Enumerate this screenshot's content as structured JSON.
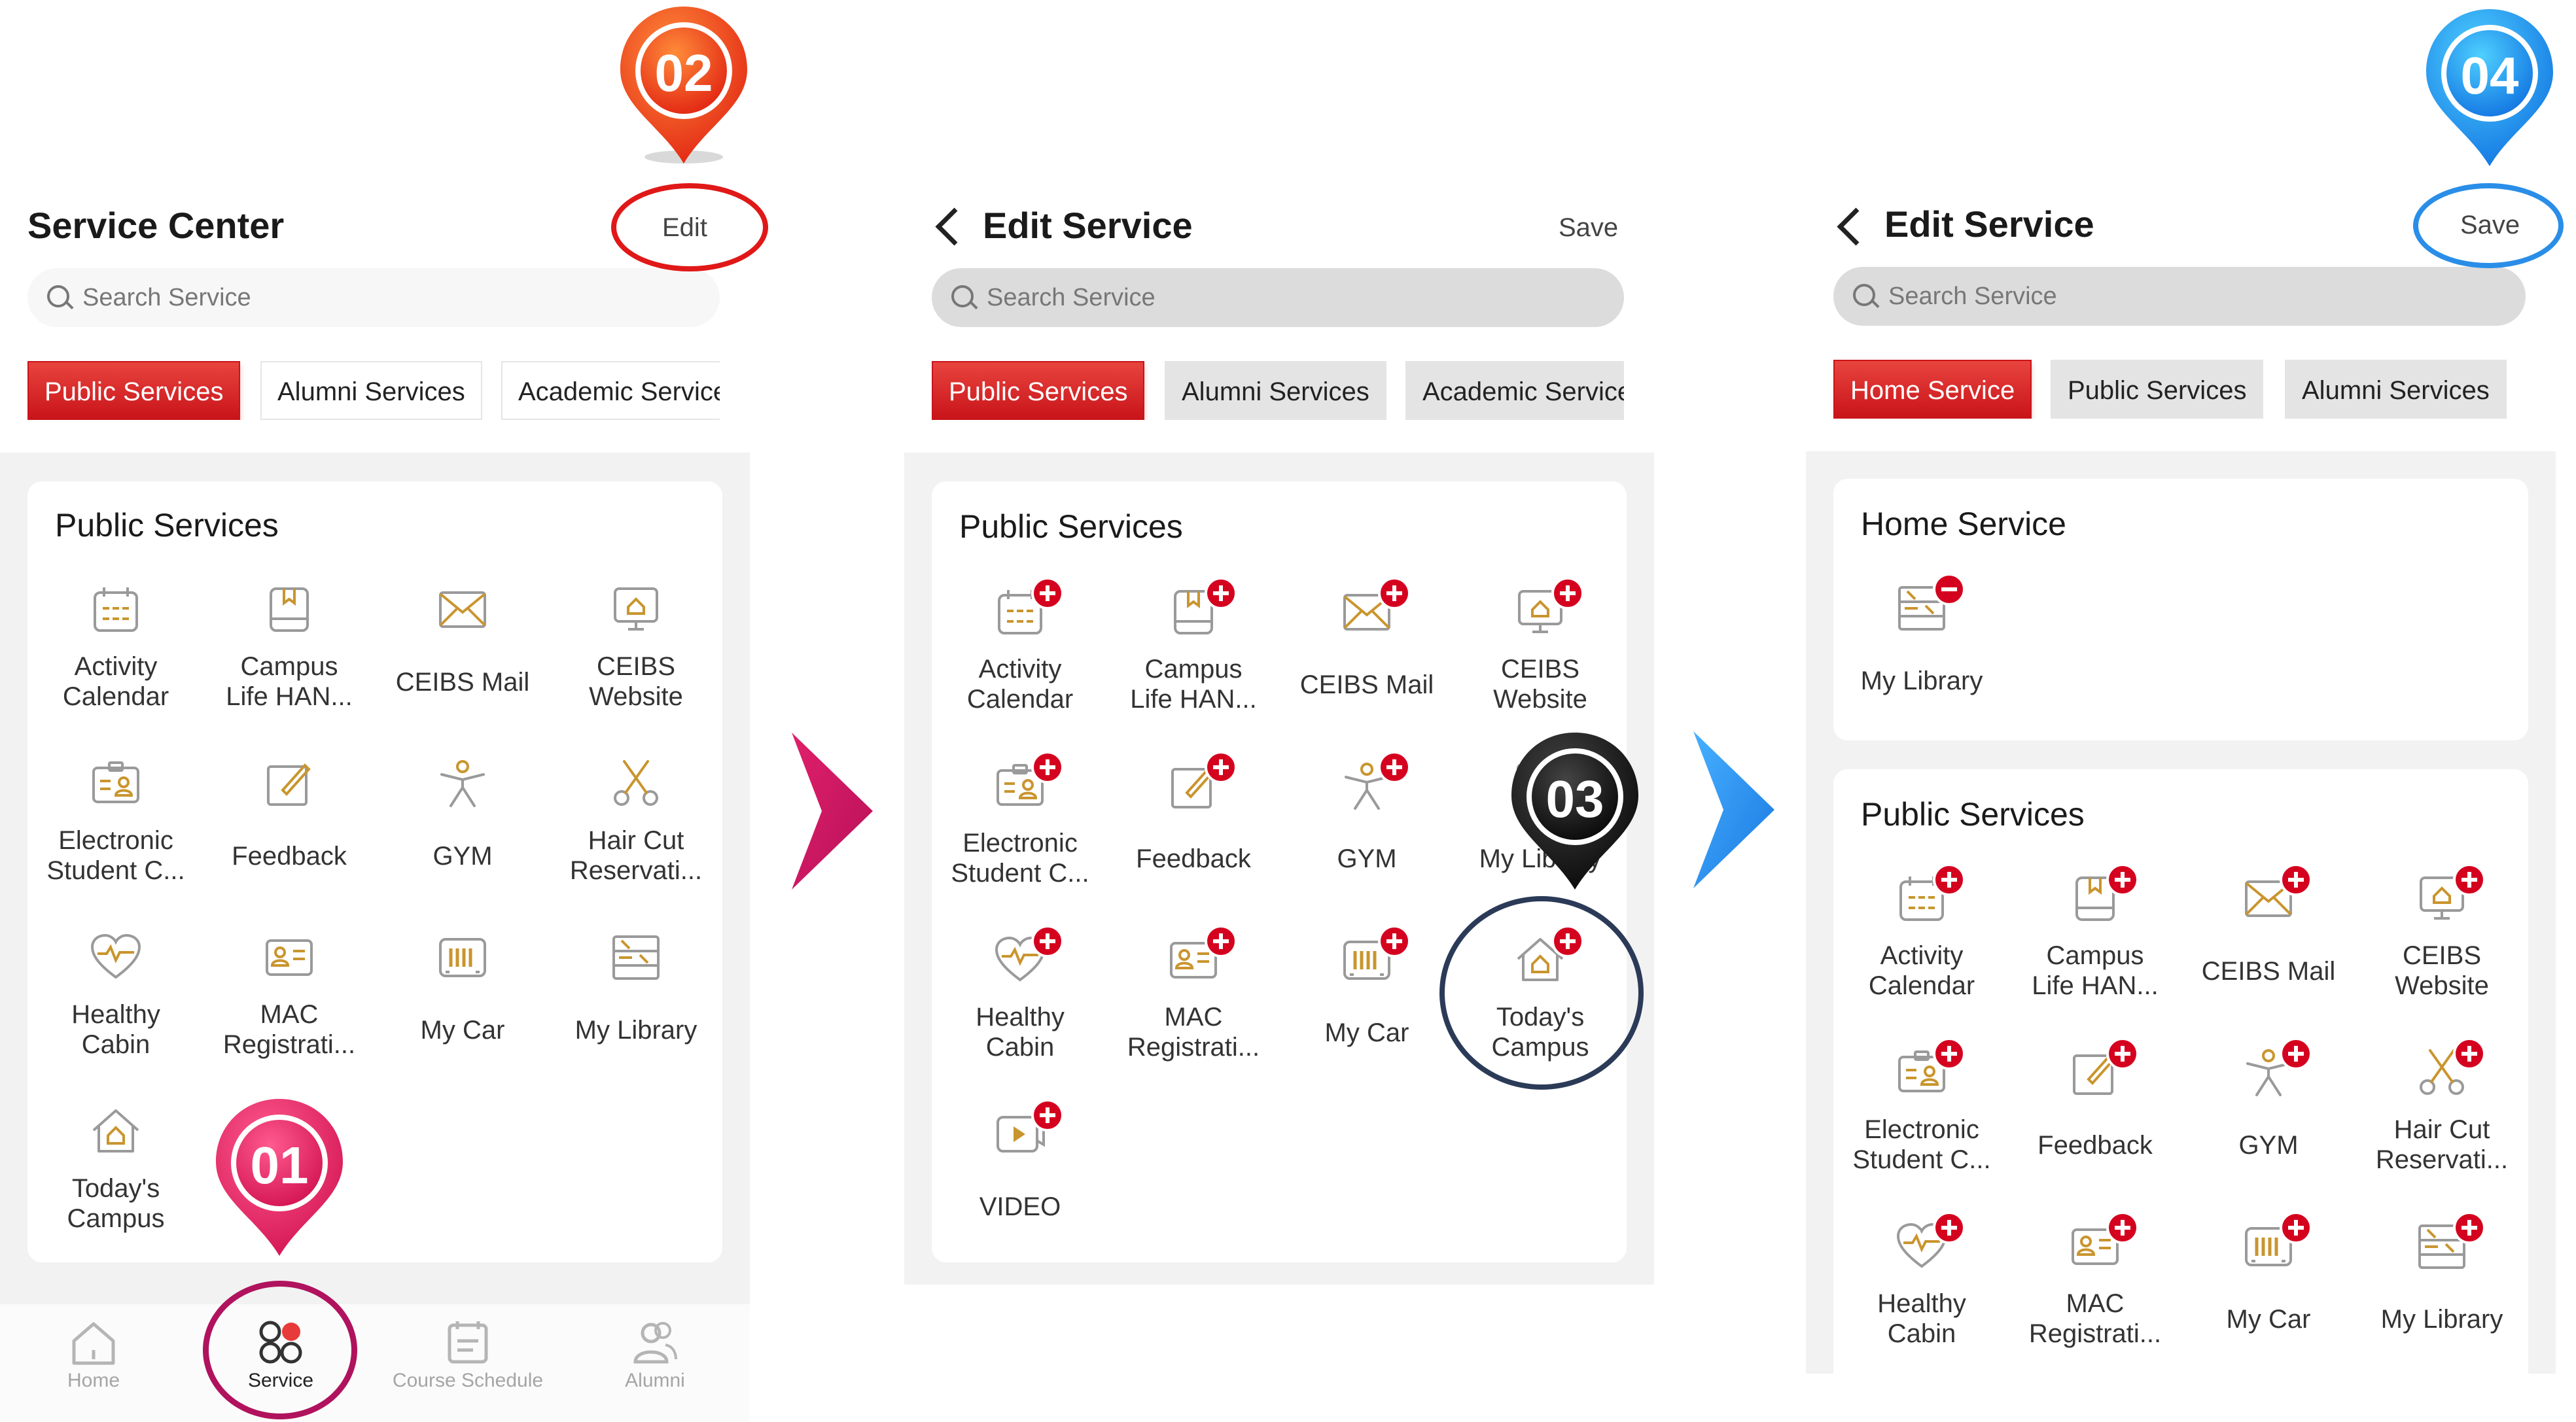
{
  "colors": {
    "accent_red": "#c9141a",
    "icon_stroke": "#9a9a9a",
    "icon_accent": "#c9952e",
    "badge": "#d4021f"
  },
  "markers": [
    {
      "label": "01",
      "color": "#e8195f"
    },
    {
      "label": "02",
      "color": "#ee3f1e"
    },
    {
      "label": "03",
      "color": "#111111"
    },
    {
      "label": "04",
      "color": "#1b8ff0"
    }
  ],
  "panel1": {
    "title": "Service Center",
    "action": "Edit",
    "search_placeholder": "Search Service",
    "tabs": [
      "Public Services",
      "Alumni Services",
      "Academic Service"
    ],
    "section_title": "Public Services",
    "items": [
      {
        "icon": "calendar-icon",
        "label": "Activity\nCalendar"
      },
      {
        "icon": "book-icon",
        "label": "Campus\nLife HAN..."
      },
      {
        "icon": "mail-icon",
        "label": "CEIBS Mail"
      },
      {
        "icon": "monitor-home-icon",
        "label": "CEIBS\nWebsite"
      },
      {
        "icon": "id-card-icon",
        "label": "Electronic\nStudent C..."
      },
      {
        "icon": "pencil-square-icon",
        "label": "Feedback"
      },
      {
        "icon": "gym-person-icon",
        "label": "GYM"
      },
      {
        "icon": "scissors-icon",
        "label": "Hair Cut\nReservati..."
      },
      {
        "icon": "heart-pulse-icon",
        "label": "Healthy\nCabin"
      },
      {
        "icon": "contact-card-icon",
        "label": "MAC\nRegistrati..."
      },
      {
        "icon": "barcode-car-icon",
        "label": "My Car"
      },
      {
        "icon": "library-icon",
        "label": "My Library"
      },
      {
        "icon": "house-icon",
        "label": "Today's\nCampus"
      }
    ],
    "nav": [
      {
        "icon": "home-icon",
        "label": "Home"
      },
      {
        "icon": "service-icon",
        "label": "Service"
      },
      {
        "icon": "schedule-icon",
        "label": "Course Schedule"
      },
      {
        "icon": "alumni-icon",
        "label": "Alumni"
      }
    ]
  },
  "panel2": {
    "title": "Edit Service",
    "action": "Save",
    "search_placeholder": "Search Service",
    "tabs": [
      "Public Services",
      "Alumni Services",
      "Academic Service"
    ],
    "section_title": "Public Services",
    "items": [
      {
        "icon": "calendar-icon",
        "label": "Activity\nCalendar"
      },
      {
        "icon": "book-icon",
        "label": "Campus\nLife HAN..."
      },
      {
        "icon": "mail-icon",
        "label": "CEIBS Mail"
      },
      {
        "icon": "monitor-home-icon",
        "label": "CEIBS\nWebsite"
      },
      {
        "icon": "id-card-icon",
        "label": "Electronic\nStudent C..."
      },
      {
        "icon": "pencil-square-icon",
        "label": "Feedback"
      },
      {
        "icon": "gym-person-icon",
        "label": "GYM"
      },
      {
        "icon": "library-icon",
        "label": "My Library"
      },
      {
        "icon": "heart-pulse-icon",
        "label": "Healthy\nCabin"
      },
      {
        "icon": "contact-card-icon",
        "label": "MAC\nRegistrati..."
      },
      {
        "icon": "barcode-car-icon",
        "label": "My Car"
      },
      {
        "icon": "house-icon",
        "label": "Today's\nCampus"
      },
      {
        "icon": "video-icon",
        "label": "VIDEO"
      }
    ]
  },
  "panel3": {
    "title": "Edit Service",
    "action": "Save",
    "search_placeholder": "Search Service",
    "tabs": [
      "Home Service",
      "Public Services",
      "Alumni Services"
    ],
    "home_section_title": "Home Service",
    "home_items": [
      {
        "icon": "library-icon",
        "label": "My Library"
      }
    ],
    "section_title": "Public Services",
    "items": [
      {
        "icon": "calendar-icon",
        "label": "Activity\nCalendar"
      },
      {
        "icon": "book-icon",
        "label": "Campus\nLife HAN..."
      },
      {
        "icon": "mail-icon",
        "label": "CEIBS Mail"
      },
      {
        "icon": "monitor-home-icon",
        "label": "CEIBS\nWebsite"
      },
      {
        "icon": "id-card-icon",
        "label": "Electronic\nStudent C..."
      },
      {
        "icon": "pencil-square-icon",
        "label": "Feedback"
      },
      {
        "icon": "gym-person-icon",
        "label": "GYM"
      },
      {
        "icon": "scissors-icon",
        "label": "Hair Cut\nReservati..."
      },
      {
        "icon": "heart-pulse-icon",
        "label": "Healthy\nCabin"
      },
      {
        "icon": "contact-card-icon",
        "label": "MAC\nRegistrati..."
      },
      {
        "icon": "barcode-car-icon",
        "label": "My Car"
      },
      {
        "icon": "library-icon",
        "label": "My Library"
      }
    ]
  }
}
